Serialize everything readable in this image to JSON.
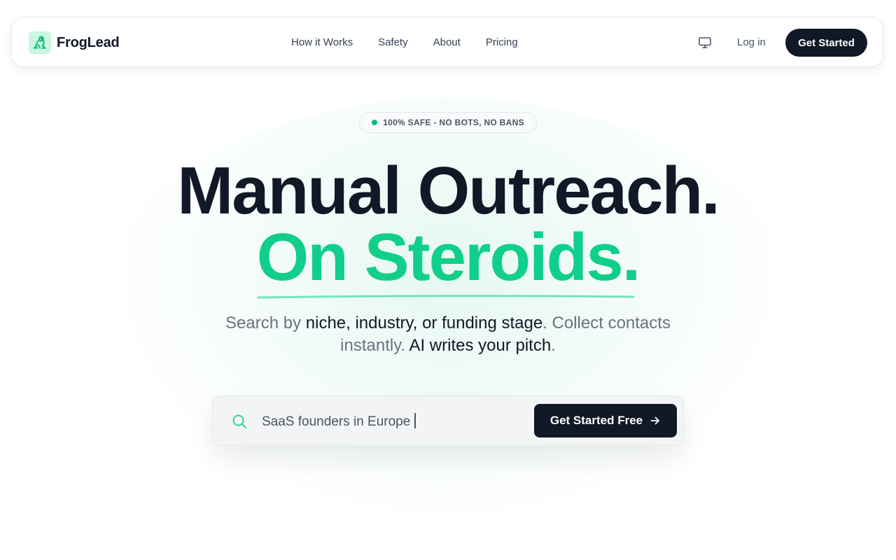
{
  "brand": {
    "name": "FrogLead",
    "logo_icon": "frog-icon",
    "logo_bg": "#c9f7e0",
    "logo_fg": "#10b981"
  },
  "nav": {
    "links": [
      "How it Works",
      "Safety",
      "About",
      "Pricing"
    ],
    "theme_icon": "monitor-icon",
    "login_label": "Log in",
    "cta_label": "Get Started"
  },
  "badge": {
    "text": "100% SAFE - NO BOTS, NO BANS",
    "dot_color": "#10b981"
  },
  "hero": {
    "headline": "Manual Outreach.",
    "accent": "On Steroids.",
    "accent_color": "#10cf8a",
    "subtitle": {
      "part1": "Search by ",
      "em1": "niche, industry, or funding stage",
      "part2": ". Collect contacts instantly. ",
      "em2": "AI writes your pitch",
      "part3": "."
    }
  },
  "search": {
    "icon": "search-icon",
    "value": "SaaS founders in Europe",
    "cta_label": "Get Started Free",
    "cta_icon": "arrow-right-icon"
  },
  "colors": {
    "dark": "#111827",
    "muted": "#6b7280",
    "accent": "#10cf8a"
  }
}
